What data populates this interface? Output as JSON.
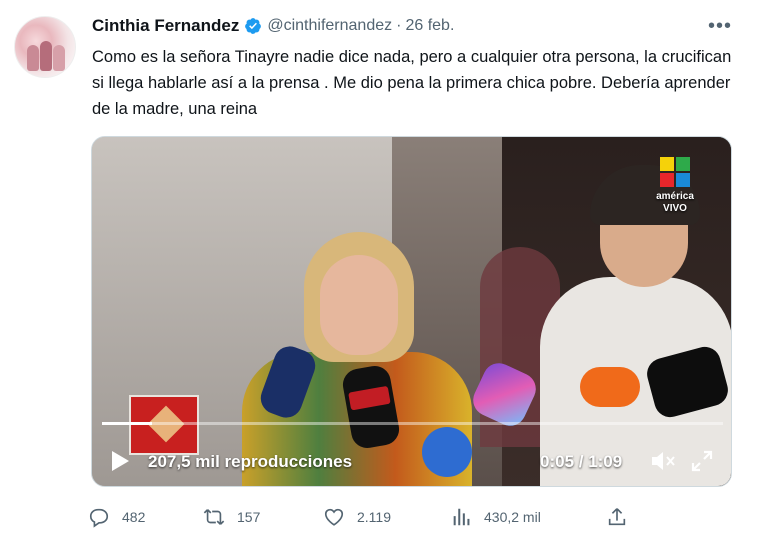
{
  "tweet": {
    "author_name": "Cinthia Fernandez",
    "handle": "@cinthifernandez",
    "separator": "·",
    "date": "26 feb.",
    "more_label": "•••",
    "text": "Como es la señora Tinayre nadie dice nada, pero a cualquier otra persona, la crucifican si llega hablarle así a la prensa . Me dio pena la primera chica pobre. Debería aprender de la madre, una reina"
  },
  "video": {
    "channel_name": "américa",
    "channel_live": "VIVO",
    "views": "207,5 mil reproducciones",
    "time": "0:05 / 1:09",
    "progress_fraction": 0.08
  },
  "actions": {
    "replies": "482",
    "retweets": "157",
    "likes": "2.119",
    "views": "430,2 mil"
  },
  "icons": {
    "verified": "verified-badge-icon",
    "reply": "reply-icon",
    "retweet": "retweet-icon",
    "like": "heart-icon",
    "views": "bar-chart-icon",
    "share": "share-icon",
    "play": "play-icon",
    "mute": "mute-icon",
    "expand": "fullscreen-icon"
  },
  "colors": {
    "verified": "#1d9bf0",
    "muted_text": "#536471",
    "text": "#0f1419"
  }
}
